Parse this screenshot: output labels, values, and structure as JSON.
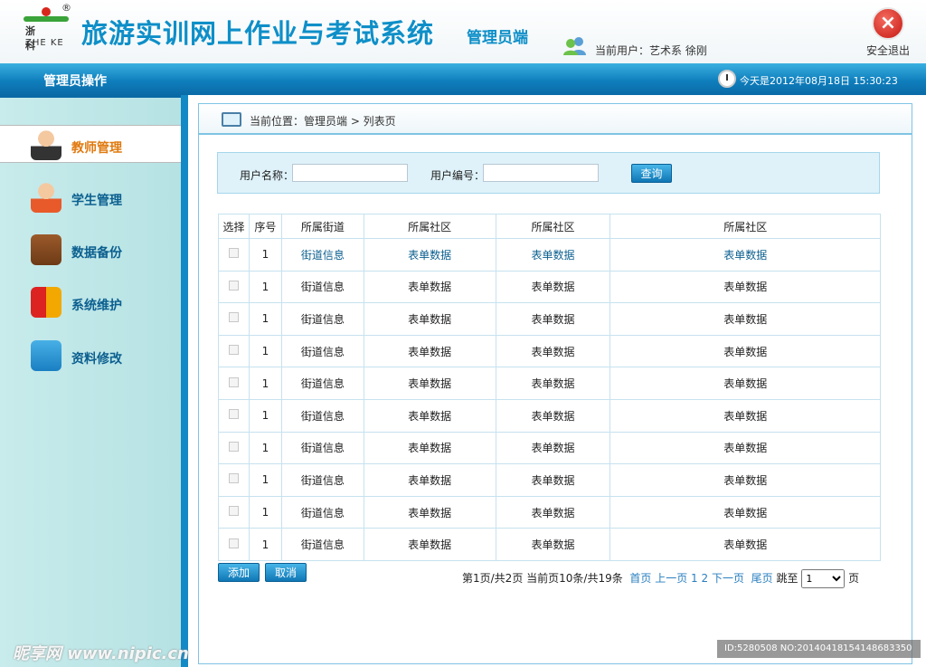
{
  "header": {
    "logo": {
      "reg": "®",
      "cn": "浙 科",
      "en": "ZHE KE"
    },
    "title": "旅游实训网上作业与考试系统",
    "subtitle": "管理员端",
    "current_user": "当前用户：艺术系  徐刚",
    "exit_label": "安全退出"
  },
  "navbar": {
    "title": "管理员操作",
    "date": "今天是2012年08月18日  15:30:23"
  },
  "sidebar": {
    "items": [
      {
        "label": "教师管理",
        "icon": "teacher-icon"
      },
      {
        "label": "学生管理",
        "icon": "student-icon"
      },
      {
        "label": "数据备份",
        "icon": "briefcase-icon"
      },
      {
        "label": "系统维护",
        "icon": "shield-icon"
      },
      {
        "label": "资料修改",
        "icon": "id-card-icon"
      }
    ]
  },
  "breadcrumb": "当前位置：管理员端 > 列表页",
  "search": {
    "username_label": "用户名称：",
    "username_value": "",
    "userid_label": "用户编号：",
    "userid_value": "",
    "query_label": "查询"
  },
  "table": {
    "headers": [
      "选择",
      "序号",
      "所属街道",
      "所属社区",
      "所属社区",
      "所属社区"
    ],
    "rows": [
      [
        "1",
        "街道信息",
        "表单数据",
        "表单数据",
        "表单数据"
      ],
      [
        "1",
        "街道信息",
        "表单数据",
        "表单数据",
        "表单数据"
      ],
      [
        "1",
        "街道信息",
        "表单数据",
        "表单数据",
        "表单数据"
      ],
      [
        "1",
        "街道信息",
        "表单数据",
        "表单数据",
        "表单数据"
      ],
      [
        "1",
        "街道信息",
        "表单数据",
        "表单数据",
        "表单数据"
      ],
      [
        "1",
        "街道信息",
        "表单数据",
        "表单数据",
        "表单数据"
      ],
      [
        "1",
        "街道信息",
        "表单数据",
        "表单数据",
        "表单数据"
      ],
      [
        "1",
        "街道信息",
        "表单数据",
        "表单数据",
        "表单数据"
      ],
      [
        "1",
        "街道信息",
        "表单数据",
        "表单数据",
        "表单数据"
      ],
      [
        "1",
        "街道信息",
        "表单数据",
        "表单数据",
        "表单数据"
      ]
    ]
  },
  "actions": {
    "add": "添加",
    "cancel": "取消"
  },
  "pager": {
    "summary": "第1页/共2页  当前页10条/共19条",
    "first": "首页",
    "prev": "上一页",
    "p1": "1",
    "p2": "2",
    "next": "下一页",
    "last": "尾页",
    "jump_label": "跳至",
    "jump_value": "1",
    "page_suffix": "页"
  },
  "watermark": {
    "left": "昵享网 www.nipic.cn",
    "right": "ID:5280508 NO:20140418154148683350"
  }
}
